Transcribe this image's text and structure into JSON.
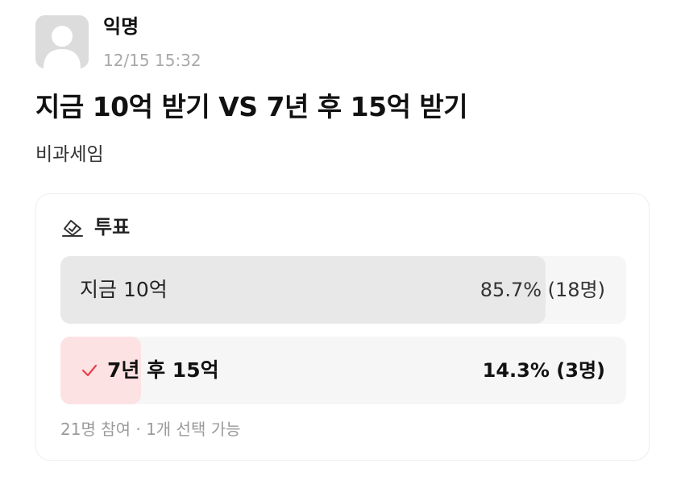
{
  "post": {
    "author": "익명",
    "time": "12/15 15:32",
    "title": "지금 10억 받기 VS 7년 후 15억 받기",
    "body": "비과세임"
  },
  "poll": {
    "label": "투표",
    "icon": "ballot-check-icon",
    "accent_color": "#e8404c",
    "options": [
      {
        "label": "지금 10억",
        "result": "85.7% (18명)",
        "percent": 85.7,
        "selected": false
      },
      {
        "label": "7년 후 15억",
        "result": "14.3% (3명)",
        "percent": 14.3,
        "selected": true
      }
    ],
    "footer": "21명 참여 · 1개 선택 가능"
  }
}
